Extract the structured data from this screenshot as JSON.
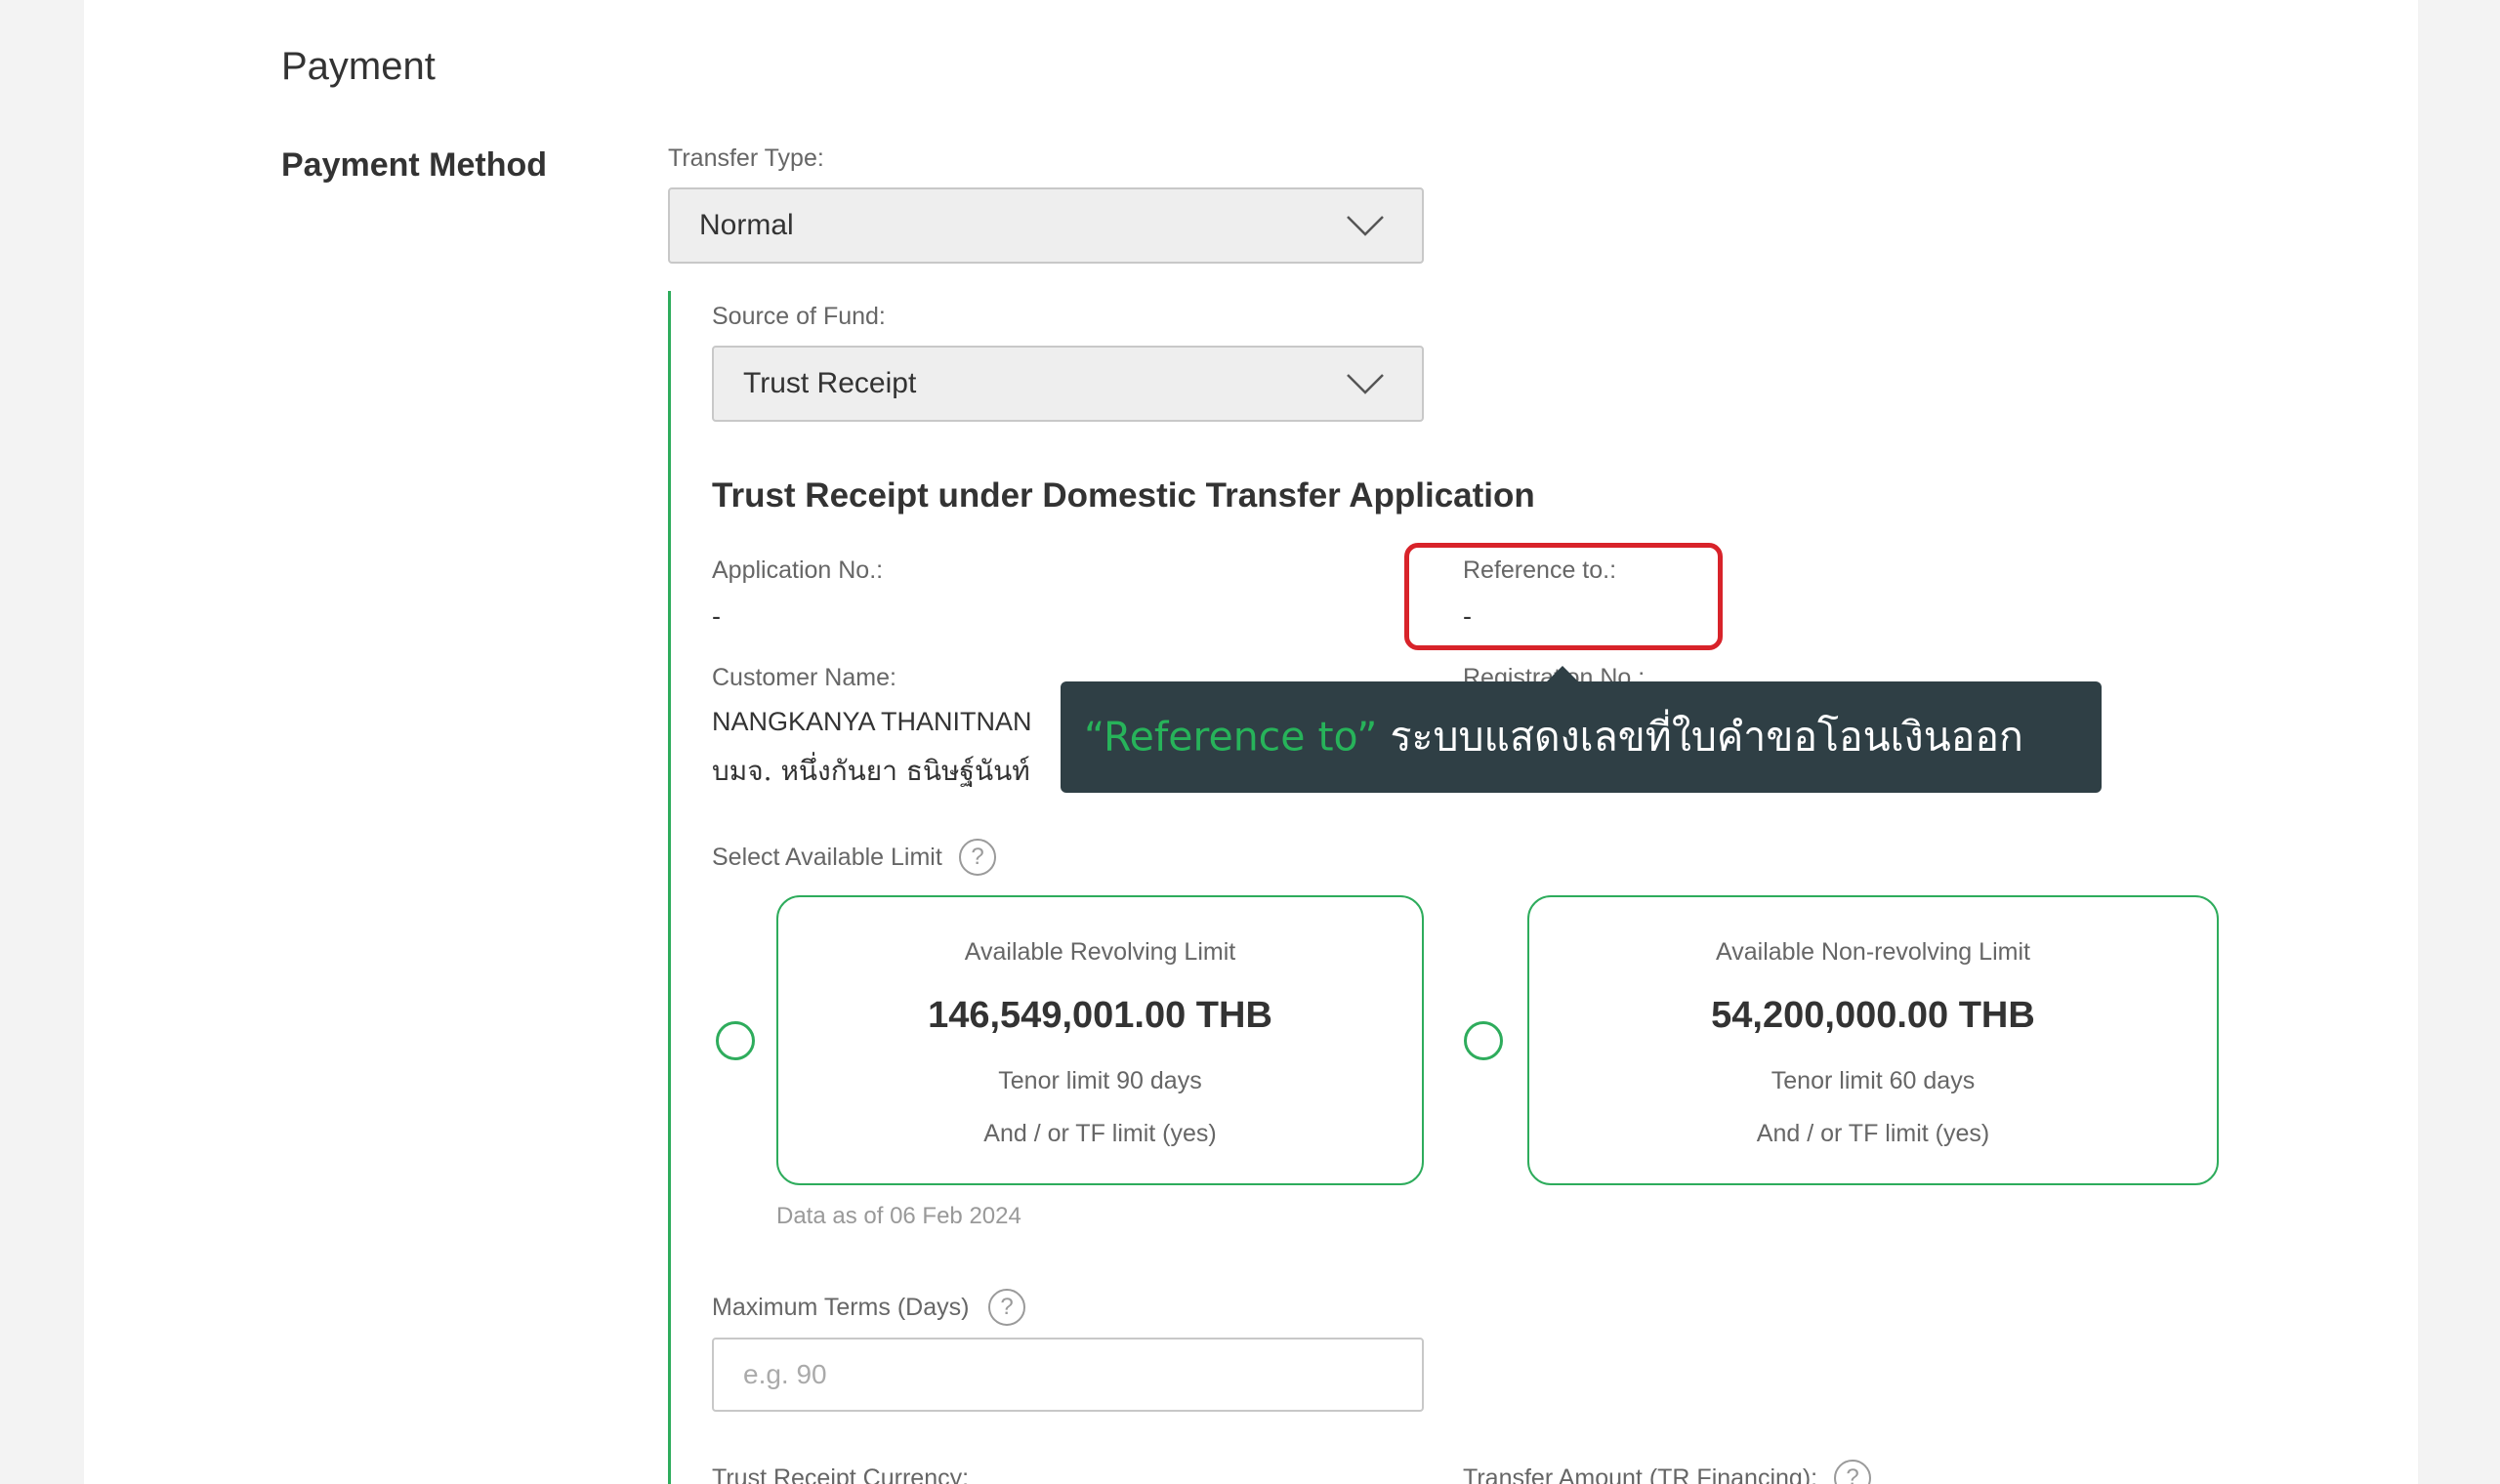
{
  "payment": {
    "section_title": "Payment",
    "method_label": "Payment Method",
    "transfer_type": {
      "label": "Transfer Type:",
      "value": "Normal"
    },
    "source_of_fund": {
      "label": "Source of Fund:",
      "value": "Trust Receipt"
    },
    "application_title": "Trust Receipt under Domestic Transfer Application",
    "application_no": {
      "label": "Application No.:",
      "value": "-"
    },
    "reference_to": {
      "label": "Reference to.:",
      "value": "-"
    },
    "customer_name": {
      "label": "Customer Name:",
      "value_en": "NANGKANYA THANITNAN",
      "value_th": "บมจ. หนึ่งกันยา ธนิษฐ์นันท์"
    },
    "registration_no": {
      "label": "Registration No.:"
    },
    "select_limit_label": "Select Available Limit",
    "limits": [
      {
        "title": "Available Revolving Limit",
        "amount": "146,549,001.00 THB",
        "tenor": "Tenor limit 90 days",
        "tf": "And / or TF limit (yes)"
      },
      {
        "title": "Available Non-revolving Limit",
        "amount": "54,200,000.00 THB",
        "tenor": "Tenor limit 60 days",
        "tf": "And / or TF limit (yes)"
      }
    ],
    "data_as_of": "Data as of 06 Feb 2024",
    "max_terms": {
      "label": "Maximum Terms (Days)",
      "placeholder": "e.g. 90"
    },
    "currency": {
      "label": "Trust Receipt Currency:"
    },
    "transfer_amount": {
      "label": "Transfer Amount (TR Financing):"
    }
  },
  "help_icon": "?",
  "tooltip": {
    "keyword": "“Reference to”",
    "text": " ระบบแสดงเลขที่ใบคำขอโอนเงินออก"
  },
  "colors": {
    "accent": "#2eac5c",
    "highlight": "#d8232a",
    "tooltip_bg": "#2f3f45"
  },
  "icons": {
    "dropdown": "chevron-down-icon",
    "help": "help-icon"
  }
}
